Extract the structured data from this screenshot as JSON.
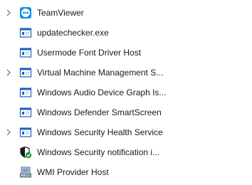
{
  "processes": [
    {
      "name": "TeamViewer",
      "expandable": true,
      "icon": "teamviewer-icon"
    },
    {
      "name": "updatechecker.exe",
      "expandable": false,
      "icon": "app-window-icon"
    },
    {
      "name": "Usermode Font Driver Host",
      "expandable": false,
      "icon": "app-window-icon"
    },
    {
      "name": "Virtual Machine Management S...",
      "expandable": true,
      "icon": "app-window-icon"
    },
    {
      "name": "Windows Audio Device Graph Is...",
      "expandable": false,
      "icon": "app-window-icon"
    },
    {
      "name": "Windows Defender SmartScreen",
      "expandable": false,
      "icon": "app-window-icon"
    },
    {
      "name": "Windows Security Health Service",
      "expandable": true,
      "icon": "app-window-icon"
    },
    {
      "name": "Windows Security notification i...",
      "expandable": false,
      "icon": "shield-check-icon"
    },
    {
      "name": "WMI Provider Host",
      "expandable": false,
      "icon": "wmi-host-icon"
    }
  ],
  "colors": {
    "text": "#1a1a1a",
    "chevron": "#6b6b6b",
    "app_icon_blue": "#1f5fbf",
    "teamviewer_blue": "#0e8ee9",
    "shield_green": "#1e9e3a"
  }
}
